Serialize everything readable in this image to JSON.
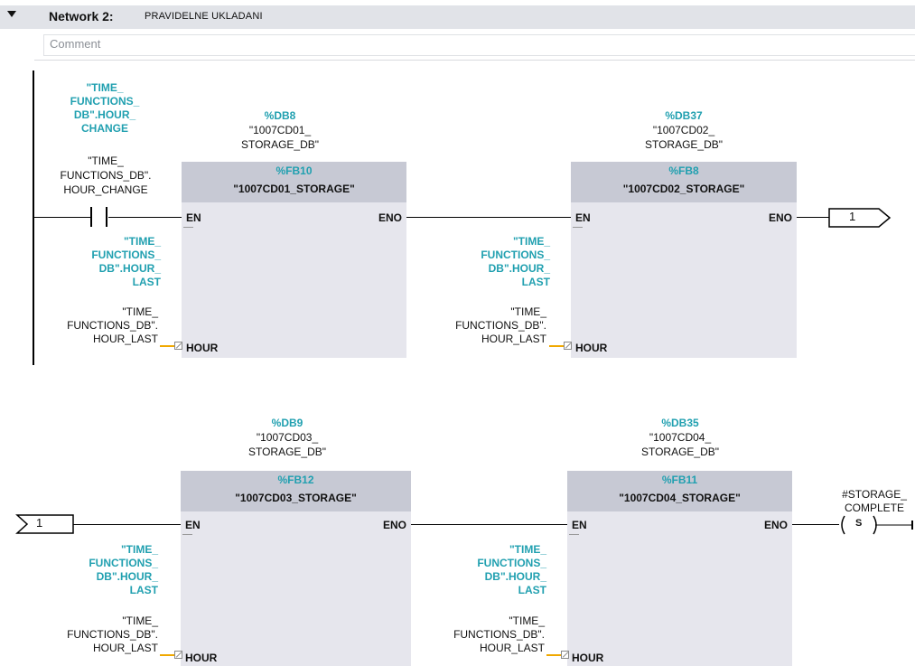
{
  "network": {
    "title": "Network 2:",
    "name": "PRAVIDELNE UKLADANI",
    "comment_placeholder": "Comment"
  },
  "contact": {
    "operand_display": [
      "\"TIME_",
      "FUNCTIONS_",
      "DB\".HOUR_",
      "CHANGE"
    ],
    "operand_symbol": [
      "\"TIME_",
      "FUNCTIONS_DB\".",
      "HOUR_CHANGE"
    ]
  },
  "blocks": [
    {
      "db": "%DB8",
      "db_symbol": [
        "\"1007CD01_",
        "STORAGE_DB\""
      ],
      "fb": "%FB10",
      "fb_name": "\"1007CD01_STORAGE\"",
      "param_display": [
        "\"TIME_",
        "FUNCTIONS_",
        "DB\".HOUR_",
        "LAST"
      ],
      "param_symbol": [
        "\"TIME_",
        "FUNCTIONS_DB\".",
        "HOUR_LAST"
      ]
    },
    {
      "db": "%DB37",
      "db_symbol": [
        "\"1007CD02_",
        "STORAGE_DB\""
      ],
      "fb": "%FB8",
      "fb_name": "\"1007CD02_STORAGE\"",
      "param_display": [
        "\"TIME_",
        "FUNCTIONS_",
        "DB\".HOUR_",
        "LAST"
      ],
      "param_symbol": [
        "\"TIME_",
        "FUNCTIONS_DB\".",
        "HOUR_LAST"
      ]
    },
    {
      "db": "%DB9",
      "db_symbol": [
        "\"1007CD03_",
        "STORAGE_DB\""
      ],
      "fb": "%FB12",
      "fb_name": "\"1007CD03_STORAGE\"",
      "param_display": [
        "\"TIME_",
        "FUNCTIONS_",
        "DB\".HOUR_",
        "LAST"
      ],
      "param_symbol": [
        "\"TIME_",
        "FUNCTIONS_DB\".",
        "HOUR_LAST"
      ]
    },
    {
      "db": "%DB35",
      "db_symbol": [
        "\"1007CD04_",
        "STORAGE_DB\""
      ],
      "fb": "%FB11",
      "fb_name": "\"1007CD04_STORAGE\"",
      "param_display": [
        "\"TIME_",
        "FUNCTIONS_",
        "DB\".HOUR_",
        "LAST"
      ],
      "param_symbol": [
        "\"TIME_",
        "FUNCTIONS_DB\".",
        "HOUR_LAST"
      ]
    }
  ],
  "pins": {
    "en": "EN",
    "eno": "ENO",
    "hour": "HOUR"
  },
  "connector": {
    "out_label": "1",
    "in_label": "1"
  },
  "coil": {
    "type": "S",
    "operand": [
      "#STORAGE_",
      "COMPLETE"
    ]
  }
}
